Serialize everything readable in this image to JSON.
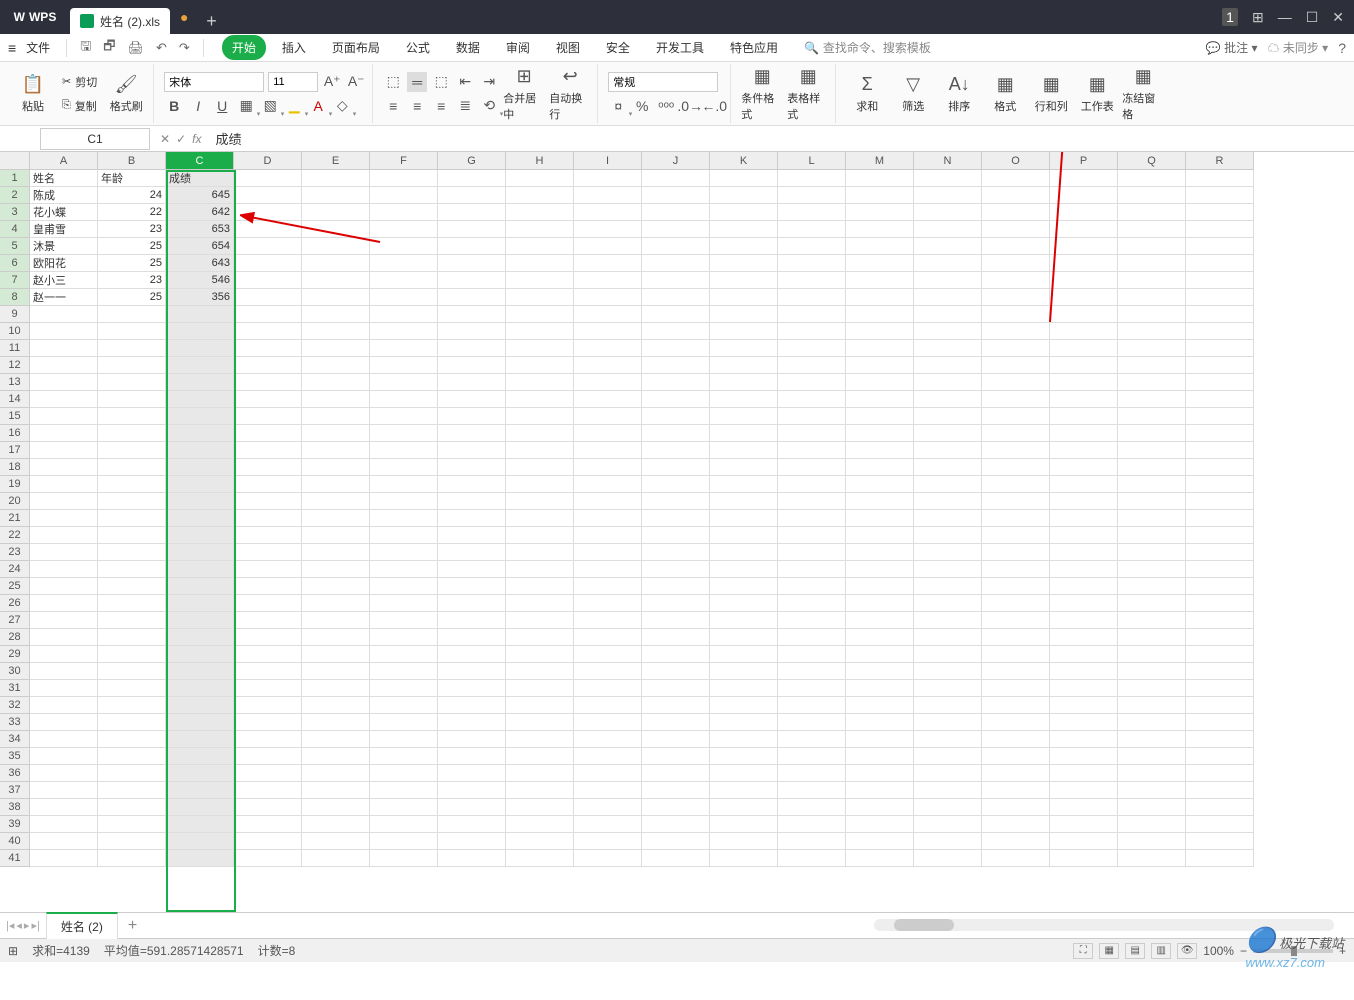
{
  "app": {
    "name": "WPS",
    "tab_title": "姓名 (2).xls"
  },
  "menubar": {
    "file": "文件",
    "tabs": [
      "开始",
      "插入",
      "页面布局",
      "公式",
      "数据",
      "审阅",
      "视图",
      "安全",
      "开发工具",
      "特色应用"
    ],
    "active_tab": "开始",
    "search_placeholder": "查找命令、搜索模板",
    "batch_note": "批注",
    "sync": "未同步"
  },
  "ribbon": {
    "paste": "粘贴",
    "cut": "剪切",
    "copy": "复制",
    "format_painter": "格式刷",
    "font_name": "宋体",
    "font_size": "11",
    "merge_center": "合并居中",
    "auto_wrap": "自动换行",
    "num_format": "常规",
    "cond_fmt": "条件格式",
    "table_style": "表格样式",
    "sum": "求和",
    "filter": "筛选",
    "sort": "排序",
    "format": "格式",
    "row_col": "行和列",
    "sheet_btn": "工作表",
    "freeze": "冻结窗格"
  },
  "formula": {
    "name_box": "C1",
    "value": "成绩"
  },
  "columns": [
    "A",
    "B",
    "C",
    "D",
    "E",
    "F",
    "G",
    "H",
    "I",
    "J",
    "K",
    "L",
    "M",
    "N",
    "O",
    "P",
    "Q",
    "R"
  ],
  "rows": 41,
  "selected_column": "C",
  "data": {
    "headers": [
      "姓名",
      "年龄",
      "成绩"
    ],
    "rows": [
      [
        "陈成",
        "24",
        "645"
      ],
      [
        "花小蝶",
        "22",
        "642"
      ],
      [
        "皇甫雪",
        "23",
        "653"
      ],
      [
        "沐景",
        "25",
        "654"
      ],
      [
        "欧阳花",
        "25",
        "643"
      ],
      [
        "赵小三",
        "23",
        "546"
      ],
      [
        "赵一一",
        "25",
        "356"
      ]
    ]
  },
  "sheet": {
    "name": "姓名 (2)"
  },
  "status": {
    "sum_label": "求和",
    "sum": "4139",
    "avg_label": "平均值",
    "avg": "591.28571428571",
    "count_label": "计数",
    "count": "8",
    "zoom": "100%"
  },
  "watermark": {
    "cn": "极光下载站",
    "url": "www.xz7.com"
  }
}
